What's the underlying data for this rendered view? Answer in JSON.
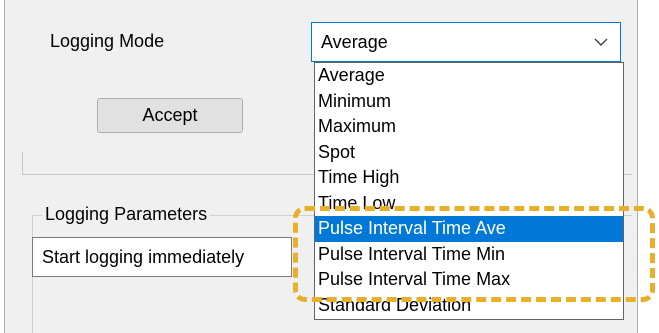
{
  "logging_mode": {
    "label": "Logging Mode",
    "selected": "Average",
    "options": [
      "Average",
      "Minimum",
      "Maximum",
      "Spot",
      "Time High",
      "Time Low",
      "Pulse Interval Time Ave",
      "Pulse Interval Time Min",
      "Pulse Interval Time Max",
      "Standard Deviation"
    ],
    "highlighted_option": "Pulse Interval Time Ave"
  },
  "accept_button": {
    "label": "Accept"
  },
  "logging_parameters": {
    "title": "Logging Parameters",
    "start_option": "Start logging immediately"
  },
  "annotation": {
    "color": "#e8b02a"
  },
  "colors": {
    "selection": "#0078d7",
    "focus_border": "#0078d7"
  },
  "icons": {
    "dropdown": "chevron-down-icon"
  }
}
